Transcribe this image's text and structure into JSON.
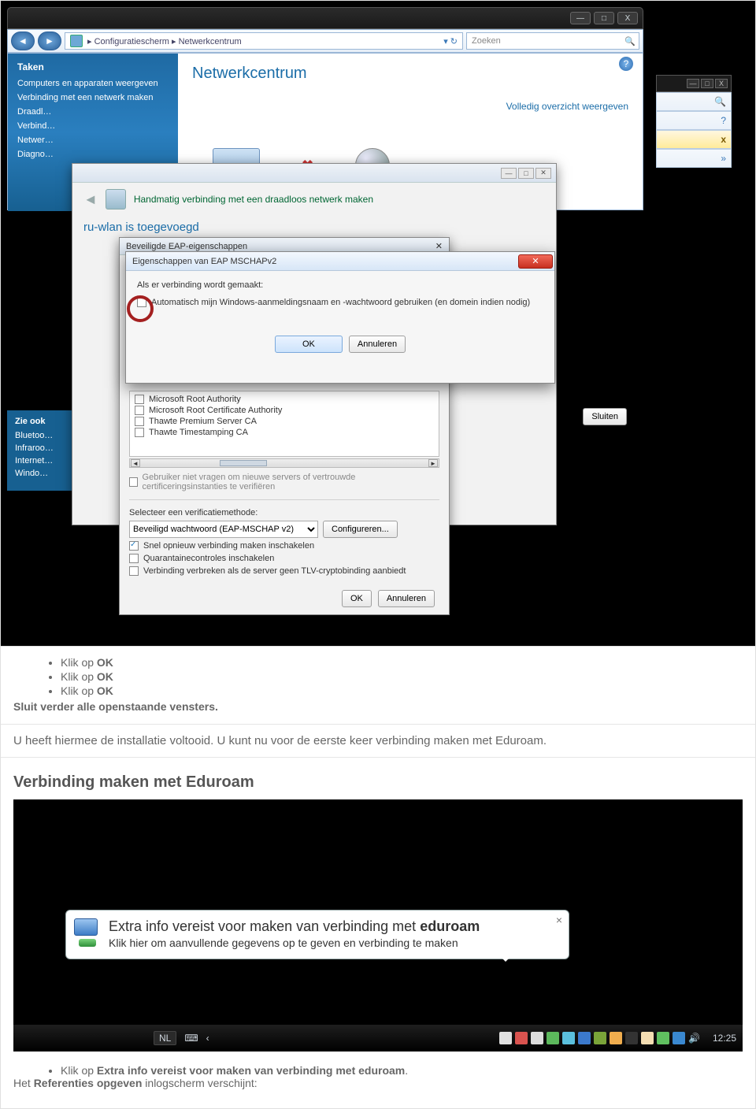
{
  "vista_window": {
    "min": "—",
    "max": "□",
    "close": "X",
    "breadcrumb": "▸ Configuratiescherm ▸ Netwerkcentrum",
    "search_placeholder": "Zoeken"
  },
  "netwerkcentrum": {
    "title": "Netwerkcentrum",
    "full_link": "Volledig overzicht weergeven",
    "sidebar_heading": "Taken",
    "sidebar_items": [
      "Computers en apparaten weergeven",
      "Verbinding met een netwerk maken",
      "Draadl…",
      "Verbind…",
      "Netwer…",
      "Diagno…"
    ]
  },
  "zie_ook": {
    "heading": "Zie ook",
    "items": [
      "Bluetoo…",
      "Infraroo…",
      "Internet…",
      "Windo…"
    ]
  },
  "mini_right": {
    "close_x": "x",
    "chev": "»"
  },
  "wizard": {
    "title": "Handmatig verbinding met een draadloos netwerk maken",
    "added": "ru-wlan is toegevoegd",
    "close_btns": [
      "—",
      "□",
      "✕"
    ],
    "sluiten": "Sluiten"
  },
  "eap_window": {
    "title": "Beveiligde EAP-eigenschappen",
    "close_icon": "✕",
    "cas": [
      "Microsoft Root Authority",
      "Microsoft Root Certificate Authority",
      "Thawte Premium Server CA",
      "Thawte Timestamping CA"
    ],
    "mute_text": "Gebruiker niet vragen om nieuwe servers of vertrouwde certificeringsinstanties te verifiëren",
    "verify_label": "Selecteer een verificatiemethode:",
    "drop_value": "Beveiligd wachtwoord (EAP-MSCHAP v2)",
    "configure": "Configureren...",
    "cb1": "Snel opnieuw verbinding maken inschakelen",
    "cb2": "Quarantainecontroles inschakelen",
    "cb3": "Verbinding verbreken als de server geen TLV-cryptobinding aanbiedt",
    "ok": "OK",
    "cancel": "Annuleren"
  },
  "mschap": {
    "title": "Eigenschappen van EAP MSCHAPv2",
    "line1": "Als er verbinding wordt gemaakt:",
    "cb": "Automatisch mijn Windows-aanmeldingsnaam en -wachtwoord gebruiken (en domein indien nodig)",
    "ok": "OK",
    "cancel": "Annuleren",
    "close": "✕"
  },
  "instructions1": {
    "bullets": [
      "Klik op ",
      "Klik op ",
      "Klik op "
    ],
    "bold": "OK",
    "close_line": "Sluit verder alle openstaande vensters."
  },
  "para1": "U heeft hiermee de installatie voltooid. U kunt nu voor de eerste keer verbinding maken met Eduroam.",
  "section_heading": "Verbinding maken met Eduroam",
  "balloon": {
    "line1a": "Extra info vereist voor maken van verbinding met ",
    "line1b": "eduroam",
    "line2": "Klik hier om aanvullende gegevens op te geven en verbinding te maken",
    "close": "×"
  },
  "taskbar": {
    "lang": "NL",
    "chev": "‹",
    "clock": "12:25",
    "tray_colors": [
      "#e0e0e0",
      "#d9534f",
      "#ddd",
      "#5cb85c",
      "#5bc0de",
      "#3b79cc",
      "#7aa439",
      "#f0ad4e",
      "#333",
      "#f5deb3",
      "#60c060",
      "#3a88d0"
    ]
  },
  "instructions2": {
    "bullet_pre": "Klik op ",
    "bullet_bold": "Extra info vereist voor maken van verbinding met eduroam",
    "line2_pre": "Het ",
    "line2_bold": "Referenties opgeven",
    "line2_post": " inlogscherm verschijnt:"
  }
}
